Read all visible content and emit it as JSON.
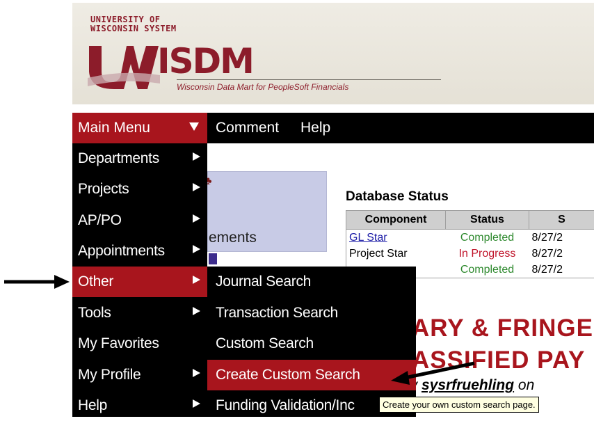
{
  "header": {
    "university_line1": "UNIVERSITY OF",
    "university_line2": "WISCONSIN SYSTEM",
    "logo_text": "ISDM",
    "tagline": "Wisconsin Data Mart for PeopleSoft Financials"
  },
  "menubar": {
    "main_menu": "Main Menu",
    "items": [
      "Comment",
      "Help"
    ]
  },
  "dropdown": {
    "items": [
      {
        "label": "Departments",
        "has_submenu": true
      },
      {
        "label": "Projects",
        "has_submenu": true
      },
      {
        "label": "AP/PO",
        "has_submenu": true
      },
      {
        "label": "Appointments",
        "has_submenu": true
      },
      {
        "label": "Other",
        "has_submenu": true,
        "active": true
      },
      {
        "label": "Tools",
        "has_submenu": true
      },
      {
        "label": "My Favorites",
        "has_submenu": false
      },
      {
        "label": "My Profile",
        "has_submenu": true
      },
      {
        "label": "Help",
        "has_submenu": true
      }
    ]
  },
  "submenu": {
    "items": [
      {
        "label": "Journal Search"
      },
      {
        "label": "Transaction Search"
      },
      {
        "label": "Custom Search"
      },
      {
        "label": "Create Custom Search",
        "active": true
      },
      {
        "label": "Funding Validation/Inc"
      }
    ]
  },
  "tooltip": "Create your own custom search page.",
  "background": {
    "announcements_fragment": "ements",
    "db_status": {
      "title": "Database Status",
      "headers": [
        "Component",
        "Status",
        "S"
      ],
      "rows": [
        {
          "component": "GL Star",
          "status": "Completed",
          "date": "8/27/2",
          "status_color": "#2f8a2f",
          "link": true
        },
        {
          "component": "Project Star",
          "status": "In Progress",
          "date": "8/27/2",
          "status_color": "#c0142a",
          "link": false
        },
        {
          "component": "",
          "status": "Completed",
          "date": "8/27/2",
          "status_color": "#2f8a2f",
          "link": false
        }
      ]
    },
    "headline_line1": "ARY & FRINGE",
    "headline_line2": "ASSIFIED PAY",
    "byline_prefix": "by",
    "byline_user": "sysrfruehling",
    "byline_suffix": "on"
  },
  "colors": {
    "brand_red": "#a8151d",
    "menu_black": "#000000",
    "tooltip_bg": "#ffffe1"
  }
}
